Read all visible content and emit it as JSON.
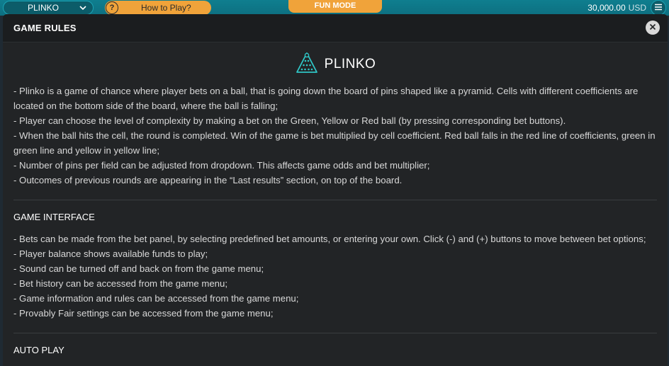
{
  "topbar": {
    "game_name": "PLINKO",
    "how_to_play": "How to Play?",
    "help_symbol": "?",
    "mode": "FUN MODE",
    "balance": "30,000.00",
    "currency": "USD"
  },
  "modal": {
    "title": "GAME RULES",
    "logo_title": "PLINKO",
    "rules": [
      "- Plinko is a game of chance where player bets on a ball, that is going down the board of pins shaped like a pyramid. Cells with different coefficients are located on the bottom side of the board, where the ball is falling;",
      "- Player can choose the level of complexity by making a bet on the Green, Yellow or Red ball (by pressing corresponding bet buttons).",
      "- When the ball hits the cell, the round is completed. Win of the game is bet multiplied by cell coefficient. Red ball falls in the red line of coefficients, green in green line and yellow in yellow line;",
      "- Number of pins per field can be adjusted from dropdown. This affects game odds and bet multiplier;",
      "- Outcomes of previous rounds are appearing in the “Last results” section, on top of the board."
    ],
    "interface_title": "GAME INTERFACE",
    "interface": [
      "- Bets can be made from the bet panel, by selecting predefined bet amounts, or entering your own. Click (-) and (+) buttons to move between bet options;",
      "- Player balance shows available funds to play;",
      "- Sound can be turned off and back on from the game menu;",
      "- Bet history can be accessed from the game menu;",
      "- Game information and rules can be accessed from the game menu;",
      "- Provably Fair settings can be accessed from the game menu;"
    ],
    "autoplay_title": "AUTO PLAY"
  },
  "colors": {
    "topbar": "#0f7e8f",
    "accent_orange": "#f0a33a",
    "modal_bg": "#222426",
    "logo_teal": "#2fc6c6"
  },
  "icons": [
    "chevron-down-icon",
    "help-icon",
    "menu-icon",
    "close-icon",
    "plinko-logo-icon"
  ]
}
